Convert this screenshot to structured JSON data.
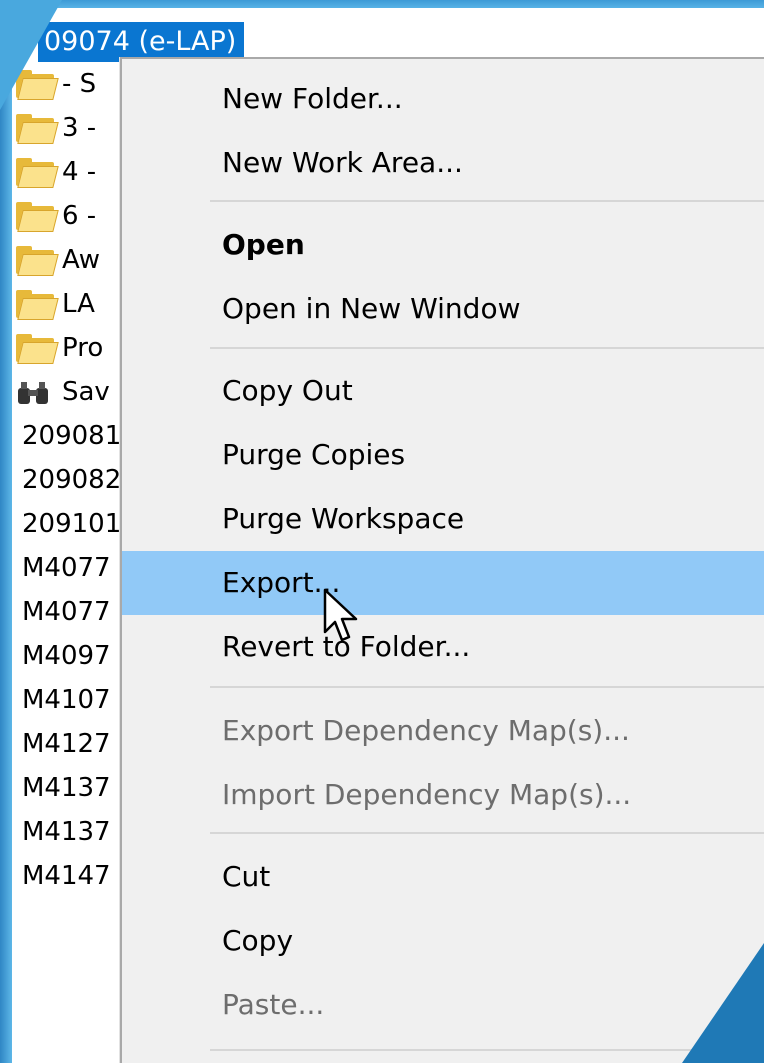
{
  "tree": {
    "root_label": "09074 (e-LAP)",
    "rows": [
      {
        "icon": "folder-icon",
        "text": "- S"
      },
      {
        "icon": "folder-icon",
        "text": "3 -"
      },
      {
        "icon": "folder-icon",
        "text": "4 -"
      },
      {
        "icon": "folder-icon",
        "text": "6 -"
      },
      {
        "icon": "folder-icon",
        "text": "Aw"
      },
      {
        "icon": "folder-icon",
        "text": "LA"
      },
      {
        "icon": "folder-icon",
        "text": "Pro"
      },
      {
        "icon": "binoculars-icon",
        "text": "Sav"
      },
      {
        "icon": "",
        "text": "209081"
      },
      {
        "icon": "",
        "text": "209082"
      },
      {
        "icon": "",
        "text": "209101"
      },
      {
        "icon": "",
        "text": "M4077"
      },
      {
        "icon": "",
        "text": "M4077"
      },
      {
        "icon": "",
        "text": "M4097"
      },
      {
        "icon": "",
        "text": "M4107"
      },
      {
        "icon": "",
        "text": "M4127"
      },
      {
        "icon": "",
        "text": "M4137"
      },
      {
        "icon": "",
        "text": "M4137"
      },
      {
        "icon": "",
        "text": "M4147"
      }
    ]
  },
  "menu": {
    "new_folder": "New Folder...",
    "new_work_area": "New Work Area...",
    "open": "Open",
    "open_new_window": "Open in New Window",
    "copy_out": "Copy Out",
    "purge_copies": "Purge Copies",
    "purge_workspace": "Purge Workspace",
    "export": "Export...",
    "revert_to_folder": "Revert to Folder...",
    "export_dependency_maps": "Export Dependency Map(s)...",
    "import_dependency_maps": "Import Dependency Map(s)...",
    "cut": "Cut",
    "copy": "Copy",
    "paste": "Paste..."
  },
  "colors": {
    "selection": "#91c9f7",
    "tree_selection": "#0a76d1",
    "menu_background": "#f0f0f0",
    "disabled_text": "#6d6d6d"
  }
}
